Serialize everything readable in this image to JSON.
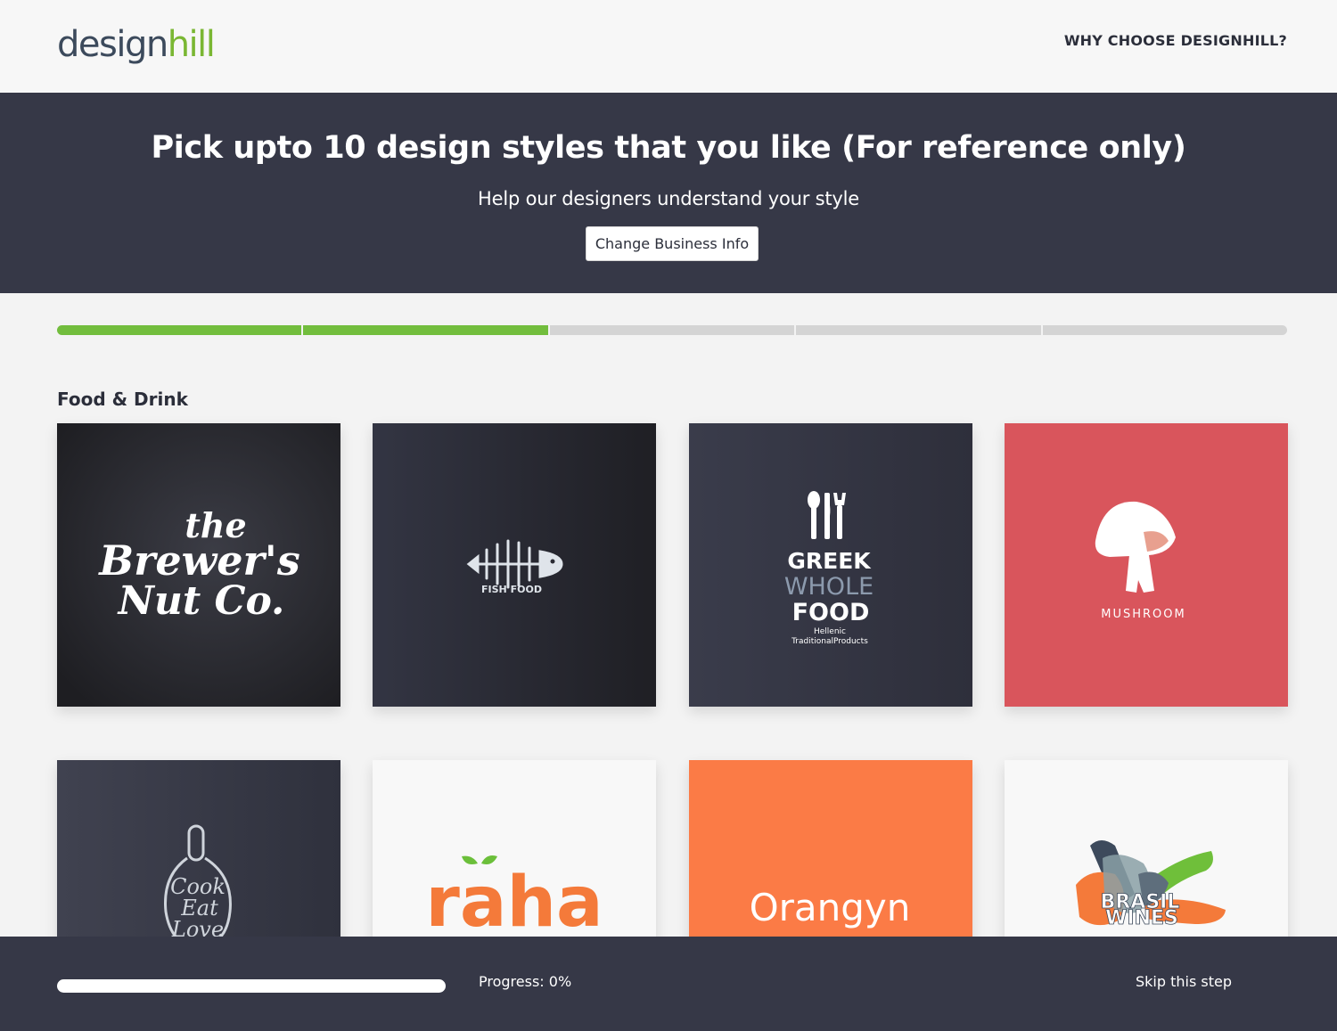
{
  "header": {
    "logo_design": "design",
    "logo_hill": "hill",
    "why_link": "WHY CHOOSE DESIGNHILL?"
  },
  "hero": {
    "title": "Pick upto 10 design styles that you like (For reference only)",
    "subtitle": "Help our designers understand your style",
    "button": "Change Business Info"
  },
  "steps": {
    "total": 5,
    "completed": 2
  },
  "category": {
    "title": "Food & Drink"
  },
  "tiles": [
    {
      "line1": "the",
      "line2": "Brewer's",
      "line3": "Nut Co."
    },
    {
      "label": "FISH FOOD"
    },
    {
      "line1": "GREEK",
      "line2": "WHOLE",
      "line3": "FOOD",
      "line4": "Hellenic",
      "line5": "TraditionalProducts"
    },
    {
      "label": "MUSHROOM"
    },
    {
      "line1": "Cook",
      "line2": "Eat",
      "line3": "Love"
    },
    {
      "label": "raha"
    },
    {
      "label": "Orangyn"
    },
    {
      "line1": "BRASIL",
      "line2": "WINES"
    }
  ],
  "colors": {
    "dark": "#363847",
    "accent_green": "#72bd3d",
    "mushroom_red": "#d9555c",
    "raha_orange": "#f47a3a",
    "orangyn_orange": "#fb7b46"
  },
  "footer": {
    "progress_value": 0,
    "progress_text": "Progress: 0%",
    "skip": "Skip this step"
  }
}
